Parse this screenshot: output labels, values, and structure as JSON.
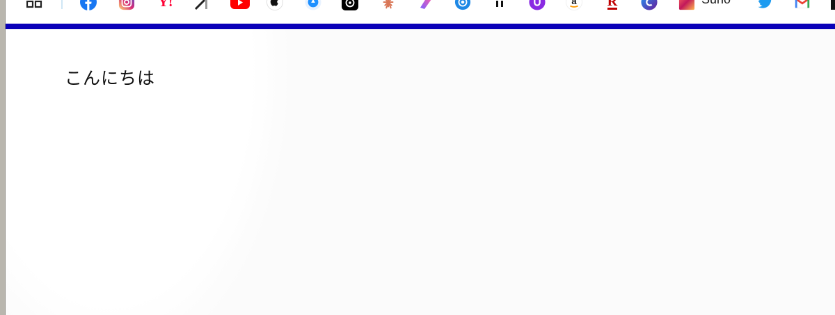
{
  "bookmarks_bar": {
    "items": [
      {
        "icon": "apps-grid-icon"
      },
      {
        "icon": "facebook-icon",
        "color": "#1877f2"
      },
      {
        "icon": "instagram-icon",
        "color": "#e1306c"
      },
      {
        "icon": "yahoo-icon",
        "text": "Y!",
        "color": "#ff0033"
      },
      {
        "icon": "arrow-icon"
      },
      {
        "icon": "youtube-icon",
        "color": "#ff0000"
      },
      {
        "icon": "apple-icon"
      },
      {
        "icon": "app-store-icon",
        "color": "#1e90ff"
      },
      {
        "icon": "chatgpt-icon"
      },
      {
        "icon": "claude-icon",
        "color": "#d97757"
      },
      {
        "icon": "gradient-bookmark-icon",
        "color": "#a259ff"
      },
      {
        "icon": "at-sign-icon",
        "color": "#1e88e5"
      },
      {
        "icon": "pause-icon"
      },
      {
        "icon": "purple-u-icon",
        "color": "#8a2be2"
      },
      {
        "icon": "amazon-icon"
      },
      {
        "icon": "rakuten-icon",
        "text": "R",
        "color": "#bf0000"
      },
      {
        "icon": "copilot-icon",
        "color": "#3f51b5"
      },
      {
        "icon": "suno-icon",
        "label": "Suno"
      },
      {
        "icon": "twitter-icon",
        "color": "#1d9bf0"
      },
      {
        "icon": "gmail-icon"
      }
    ]
  },
  "accent_colors": {
    "rule": "#0a00b8"
  },
  "page": {
    "greeting": "こんにちは"
  }
}
